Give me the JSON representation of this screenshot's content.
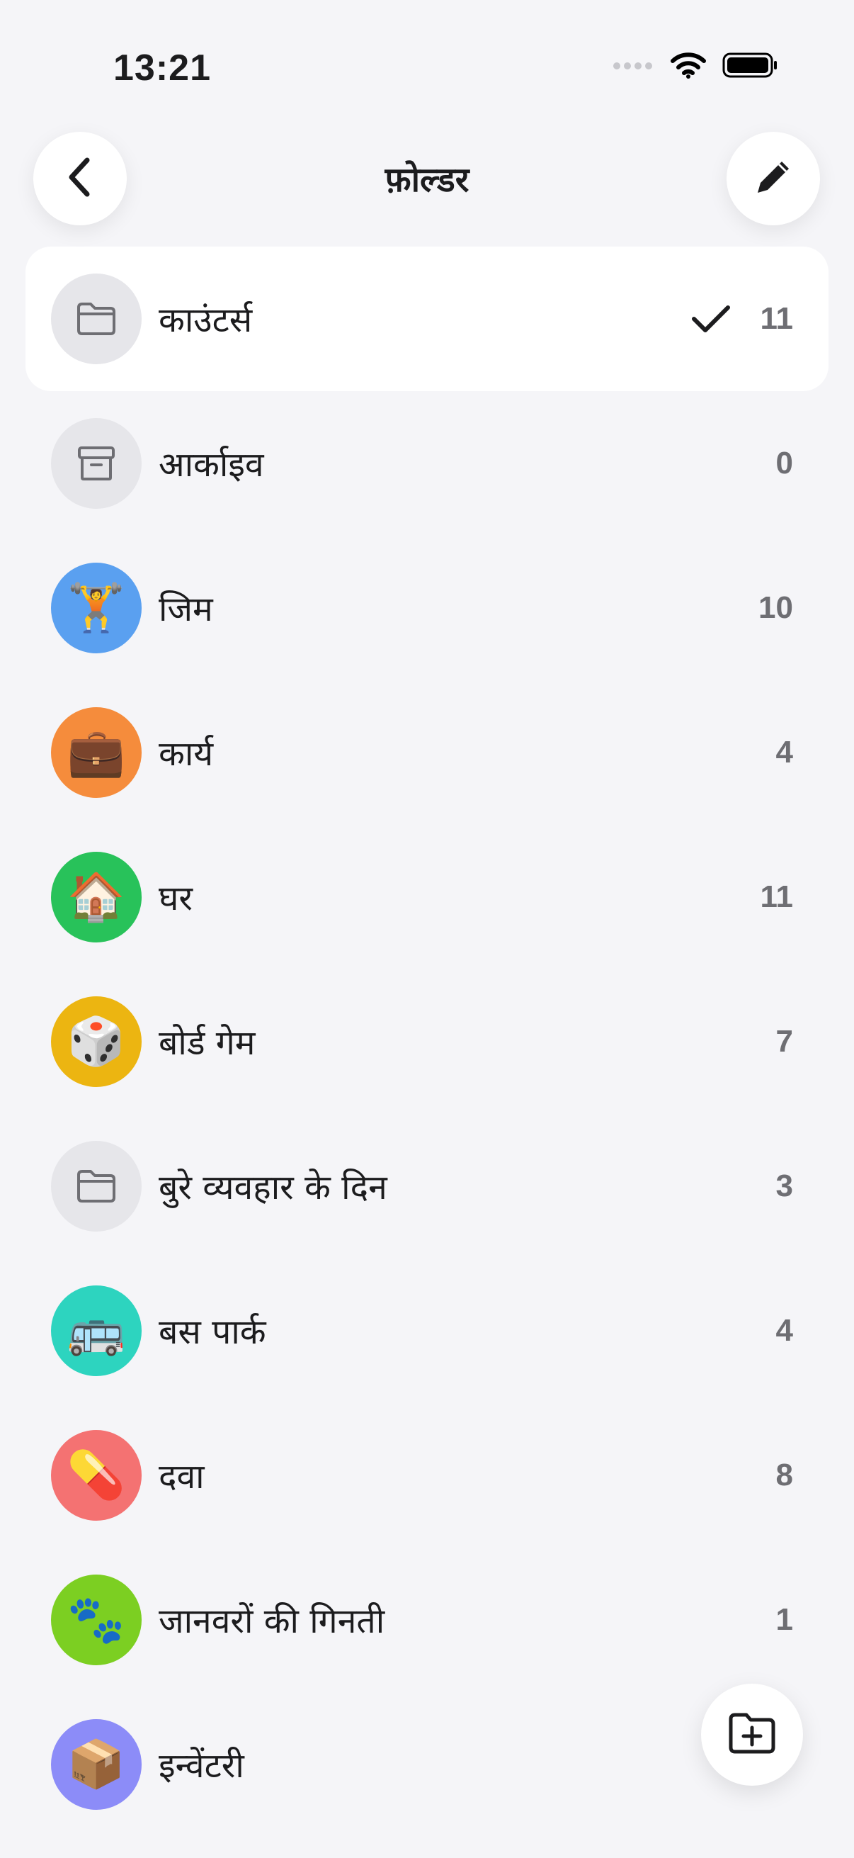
{
  "status": {
    "time": "13:21"
  },
  "header": {
    "title": "फ़ोल्डर"
  },
  "folders": [
    {
      "label": "काउंटर्स",
      "count": "11",
      "icon": "folder-icon",
      "emoji": "",
      "color": "#e6e6ea",
      "selected": true
    },
    {
      "label": "आर्काइव",
      "count": "0",
      "icon": "archive-icon",
      "emoji": "",
      "color": "#e6e6ea",
      "selected": false
    },
    {
      "label": "जिम",
      "count": "10",
      "icon": "weightlifter-icon",
      "emoji": "🏋️",
      "color": "#5aa0f0",
      "selected": false
    },
    {
      "label": "कार्य",
      "count": "4",
      "icon": "briefcase-icon",
      "emoji": "💼",
      "color": "#f58c3c",
      "selected": false
    },
    {
      "label": "घर",
      "count": "11",
      "icon": "house-icon",
      "emoji": "🏠",
      "color": "#28c25a",
      "selected": false
    },
    {
      "label": "बोर्ड गेम",
      "count": "7",
      "icon": "dice-icon",
      "emoji": "🎲",
      "color": "#ecb511",
      "selected": false
    },
    {
      "label": "बुरे व्यवहार के दिन",
      "count": "3",
      "icon": "folder-icon",
      "emoji": "",
      "color": "#e6e6ea",
      "selected": false
    },
    {
      "label": "बस पार्क",
      "count": "4",
      "icon": "bus-icon",
      "emoji": "🚌",
      "color": "#2dd4bf",
      "selected": false
    },
    {
      "label": "दवा",
      "count": "8",
      "icon": "pill-icon",
      "emoji": "💊",
      "color": "#f47272",
      "selected": false
    },
    {
      "label": "जानवरों की गिनती",
      "count": "1",
      "icon": "paw-prints-icon",
      "emoji": "🐾",
      "color": "#7ccf22",
      "selected": false
    },
    {
      "label": "इन्वेंटरी",
      "count": "",
      "icon": "package-icon",
      "emoji": "📦",
      "color": "#8c8cf8",
      "selected": false
    }
  ]
}
